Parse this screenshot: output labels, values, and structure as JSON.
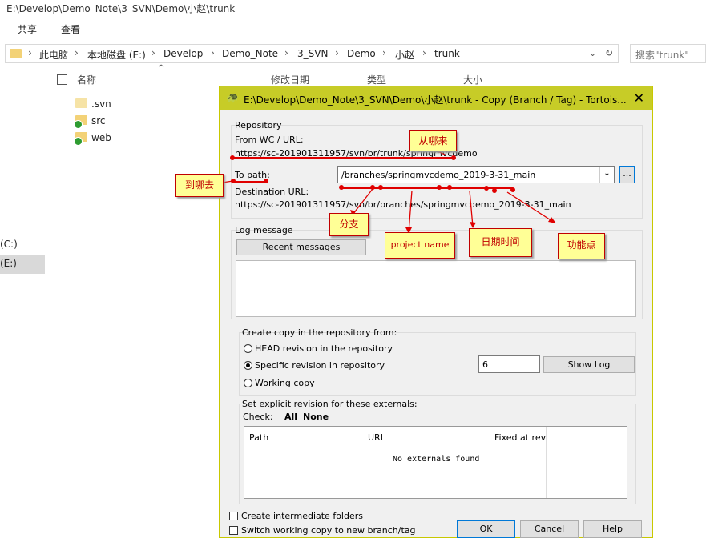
{
  "explorer": {
    "title": "E:\\Develop\\Demo_Note\\3_SVN\\Demo\\小赵\\trunk",
    "ribbon_tabs": [
      "共享",
      "查看"
    ],
    "breadcrumb": [
      "此电脑",
      "本地磁盘 (E:)",
      "Develop",
      "Demo_Note",
      "3_SVN",
      "Demo",
      "小赵",
      "trunk"
    ],
    "search_placeholder": "搜索\"trunk\"",
    "columns": {
      "name": "名称",
      "modified": "修改日期",
      "type": "类型",
      "size": "大小"
    },
    "files": [
      ".svn",
      "src",
      "web"
    ],
    "drives": [
      "(C:)",
      "(E:)"
    ]
  },
  "dialog": {
    "title": "E:\\Develop\\Demo_Note\\3_SVN\\Demo\\小赵\\trunk - Copy (Branch / Tag) - Tortois...",
    "close_glyph": "✕",
    "repository": {
      "group_label": "Repository",
      "from_label": "From WC / URL:",
      "from_url": "https://sc-201901311957/svn/br/trunk/springmvcdemo",
      "to_label": "To path:",
      "to_value": "/branches/springmvcdemo_2019-3-31_main",
      "browse_label": "...",
      "dest_label": "Destination URL:",
      "dest_url": "https://sc-201901311957/svn/br/branches/springmvcdemo_2019-3-31_main"
    },
    "log": {
      "group_label": "Log message",
      "recent_button": "Recent messages"
    },
    "create_copy": {
      "group_label": "Create copy in the repository from:",
      "options": [
        "HEAD revision in the repository",
        "Specific revision in repository",
        "Working copy"
      ],
      "selected": 1,
      "revision_value": "6",
      "show_log_button": "Show Log"
    },
    "externals": {
      "group_label": "Set explicit revision for these externals:",
      "check_label": "Check:",
      "all_link": "All",
      "none_link": "None",
      "columns": [
        "Path",
        "URL",
        "Fixed at rev"
      ],
      "empty_text": "No externals found"
    },
    "options": {
      "create_intermediate": "Create intermediate folders",
      "switch_wc": "Switch working copy to new branch/tag"
    },
    "buttons": {
      "ok": "OK",
      "cancel": "Cancel",
      "help": "Help"
    }
  },
  "annotations": {
    "from": "从哪来",
    "to": "到哪去",
    "branch": "分支",
    "project": "project name",
    "datetime": "日期时间",
    "feature": "功能点"
  },
  "colors": {
    "dialog_title_bar": "#c7cc27",
    "annotation_fill": "#ffff96",
    "annotation_border": "#c00000",
    "annotation_line": "#e00000"
  }
}
